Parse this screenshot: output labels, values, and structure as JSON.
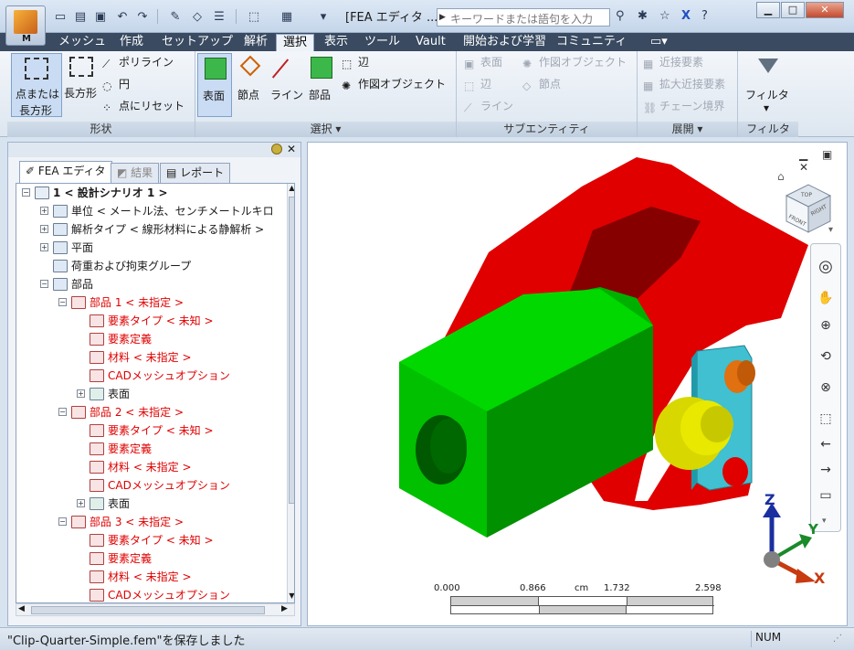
{
  "app": {
    "menu_letter": "M",
    "window_title": "[FEA エディタ ...",
    "search_placeholder": "キーワードまたは語句を入力"
  },
  "tabs": [
    "メッシュ",
    "作成",
    "セットアップ",
    "解析",
    "選択",
    "表示",
    "ツール",
    "Vault",
    "開始および学習",
    "コミュニティ"
  ],
  "active_tab": 4,
  "ribbon": {
    "shape": {
      "title": "形状",
      "point_rect_line1": "点または",
      "point_rect_line2": "長方形",
      "rect": "長方形",
      "polyline": "ポリライン",
      "circle": "円",
      "point_reset": "点にリセット"
    },
    "select": {
      "title": "選択",
      "surface": "表面",
      "node": "節点",
      "line": "ライン",
      "part": "部品",
      "edge": "辺",
      "construct": "作図オブジェクト"
    },
    "sub": {
      "title": "サブエンティティ",
      "surface": "表面",
      "edge": "辺",
      "line": "ライン",
      "construct": "作図オブジェクト",
      "node": "節点"
    },
    "expand": {
      "title": "展開",
      "near": "近接要素",
      "ext_near": "拡大近接要素",
      "chain": "チェーン境界"
    },
    "filter": {
      "title": "フィルタ",
      "filter": "フィルタ"
    }
  },
  "panel_tabs": [
    "FEA エディタ",
    "結果",
    "レポート"
  ],
  "tree": [
    {
      "indent": 0,
      "exp": "−",
      "label": "1 < 設計シナリオ 1 >",
      "red": false,
      "bold": true
    },
    {
      "indent": 1,
      "exp": "+",
      "label": "単位 < メートル法、センチメートルキロ",
      "red": false
    },
    {
      "indent": 1,
      "exp": "+",
      "label": "解析タイプ < 線形材料による静解析 >",
      "red": false
    },
    {
      "indent": 1,
      "exp": "+",
      "label": "平面",
      "red": false
    },
    {
      "indent": 1,
      "exp": "",
      "label": "荷重および拘束グループ",
      "red": false
    },
    {
      "indent": 1,
      "exp": "−",
      "label": "部品",
      "red": false
    },
    {
      "indent": 2,
      "exp": "−",
      "label": "部品 1 < 未指定 >",
      "red": true
    },
    {
      "indent": 3,
      "exp": "",
      "label": "要素タイプ < 未知 >",
      "red": true
    },
    {
      "indent": 3,
      "exp": "",
      "label": "要素定義",
      "red": true
    },
    {
      "indent": 3,
      "exp": "",
      "label": "材料 < 未指定 >",
      "red": true
    },
    {
      "indent": 3,
      "exp": "",
      "label": "CADメッシュオプション",
      "red": true
    },
    {
      "indent": 3,
      "exp": "+",
      "label": "表面",
      "red": false
    },
    {
      "indent": 2,
      "exp": "−",
      "label": "部品 2 < 未指定 >",
      "red": true
    },
    {
      "indent": 3,
      "exp": "",
      "label": "要素タイプ < 未知 >",
      "red": true
    },
    {
      "indent": 3,
      "exp": "",
      "label": "要素定義",
      "red": true
    },
    {
      "indent": 3,
      "exp": "",
      "label": "材料 < 未指定 >",
      "red": true
    },
    {
      "indent": 3,
      "exp": "",
      "label": "CADメッシュオプション",
      "red": true
    },
    {
      "indent": 3,
      "exp": "+",
      "label": "表面",
      "red": false
    },
    {
      "indent": 2,
      "exp": "−",
      "label": "部品 3 < 未指定 >",
      "red": true
    },
    {
      "indent": 3,
      "exp": "",
      "label": "要素タイプ < 未知 >",
      "red": true
    },
    {
      "indent": 3,
      "exp": "",
      "label": "要素定義",
      "red": true
    },
    {
      "indent": 3,
      "exp": "",
      "label": "材料 < 未指定 >",
      "red": true
    },
    {
      "indent": 3,
      "exp": "",
      "label": "CADメッシュオプション",
      "red": true
    }
  ],
  "viewcube": {
    "top": "TOP",
    "front": "FRONT",
    "right": "RIGHT"
  },
  "scale": {
    "t0": "0.000",
    "t1": "0.866",
    "unit": "cm",
    "t2": "1.732",
    "t3": "2.598"
  },
  "axes": {
    "z": "Z",
    "y": "Y",
    "x": "X"
  },
  "colors": {
    "red_part": "#e00000",
    "green_part": "#00b000",
    "yellow_pin": "#e0e000",
    "cyan_plate": "#40c0d0",
    "orange_pin": "#e07010"
  },
  "status": {
    "message": "\"Clip-Quarter-Simple.fem\"を保存しました",
    "num": "NUM"
  }
}
